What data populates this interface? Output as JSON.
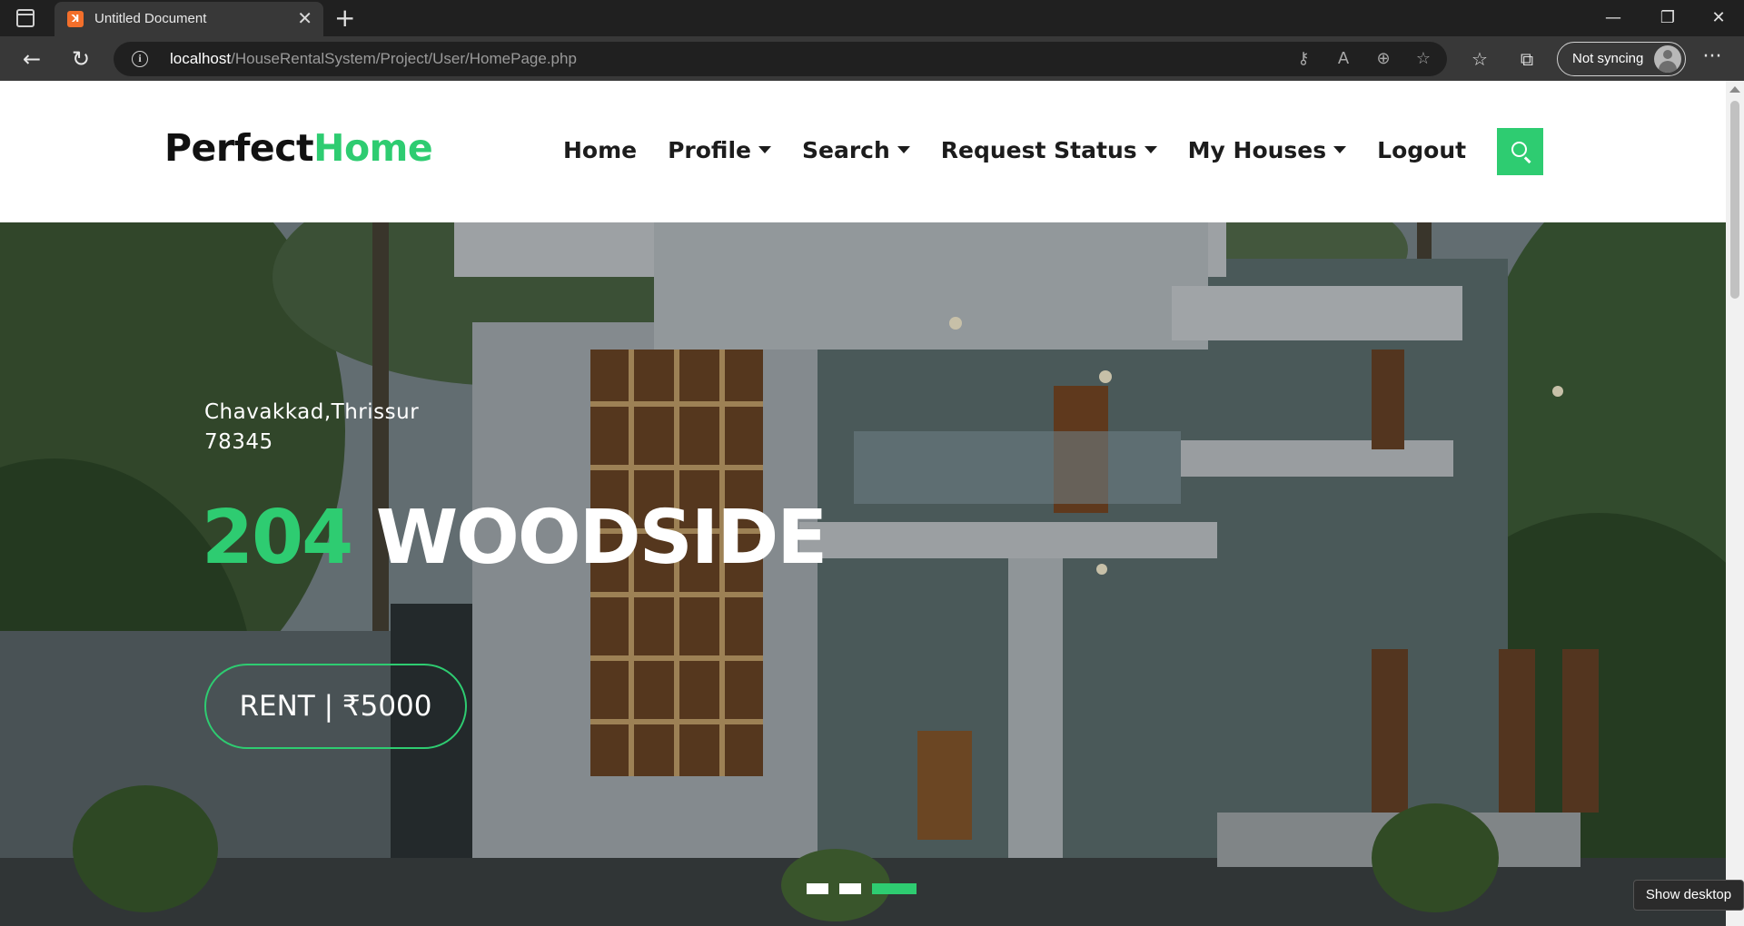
{
  "browser": {
    "tab_title": "Untitled Document",
    "url_host": "localhost",
    "url_path": "/HouseRentalSystem/Project/User/HomePage.php",
    "sync_label": "Not syncing"
  },
  "site": {
    "logo_part1": "Perfect",
    "logo_part2": "Home",
    "nav": [
      {
        "label": "Home",
        "dropdown": false
      },
      {
        "label": "Profile",
        "dropdown": true
      },
      {
        "label": "Search",
        "dropdown": true
      },
      {
        "label": "Request Status",
        "dropdown": true
      },
      {
        "label": "My Houses",
        "dropdown": true
      },
      {
        "label": "Logout",
        "dropdown": false
      }
    ]
  },
  "hero": {
    "address_line1": "Chavakkad,Thrissur",
    "address_line2": "78345",
    "house_number": "204",
    "house_name": "WOODSIDE",
    "rent_label": "RENT | ₹5000",
    "slide_count": 3,
    "active_slide": 3
  },
  "taskbar": {
    "tooltip": "Show desktop"
  },
  "colors": {
    "accent": "#2ecc71",
    "chrome_dark": "#202020",
    "chrome_toolbar": "#383838"
  }
}
